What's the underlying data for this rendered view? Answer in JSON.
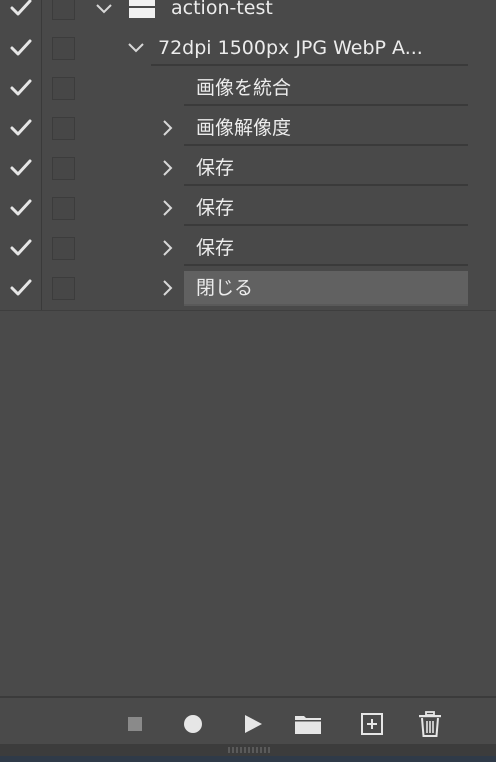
{
  "actions_panel": {
    "rows": [
      {
        "label": "action-test",
        "checked": true,
        "dialog": false,
        "type": "set",
        "expanded": true,
        "icon": "folder-icon"
      },
      {
        "label": "72dpi 1500px JPG WebP A...",
        "checked": true,
        "dialog": false,
        "type": "action",
        "expanded": true
      },
      {
        "label": "画像を統合",
        "checked": true,
        "dialog": false,
        "type": "command",
        "expandable": false
      },
      {
        "label": "画像解像度",
        "checked": true,
        "dialog": false,
        "type": "command",
        "expandable": true
      },
      {
        "label": "保存",
        "checked": true,
        "dialog": false,
        "type": "command",
        "expandable": true
      },
      {
        "label": "保存",
        "checked": true,
        "dialog": false,
        "type": "command",
        "expandable": true
      },
      {
        "label": "保存",
        "checked": true,
        "dialog": false,
        "type": "command",
        "expandable": true
      },
      {
        "label": "閉じる",
        "checked": true,
        "dialog": false,
        "type": "command",
        "expandable": true,
        "selected": true
      }
    ]
  },
  "toolbar": {
    "buttons": [
      {
        "name": "stop-recording-button",
        "icon": "stop-icon"
      },
      {
        "name": "record-button",
        "icon": "record-icon"
      },
      {
        "name": "play-button",
        "icon": "play-icon"
      },
      {
        "name": "new-set-button",
        "icon": "folder-icon"
      },
      {
        "name": "new-action-button",
        "icon": "add-icon"
      },
      {
        "name": "delete-button",
        "icon": "trash-icon"
      }
    ]
  },
  "colors": {
    "panel_bg": "#494949",
    "selected_row": "#616161",
    "text": "#ececec",
    "divider": "#3a3a3a"
  }
}
